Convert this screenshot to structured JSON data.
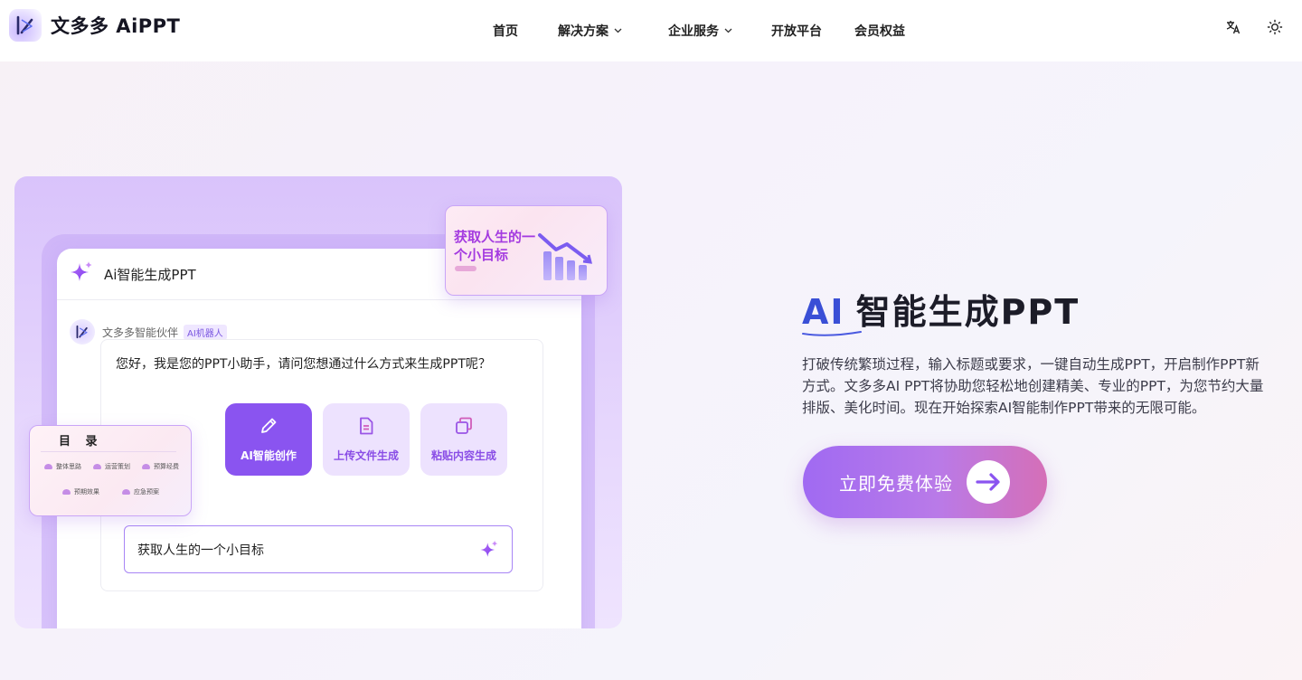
{
  "header": {
    "brand": "文多多 AiPPT",
    "nav": [
      {
        "label": "首页",
        "has_dropdown": false
      },
      {
        "label": "解决方案",
        "has_dropdown": true
      },
      {
        "label": "企业服务",
        "has_dropdown": true
      },
      {
        "label": "开放平台",
        "has_dropdown": false
      },
      {
        "label": "会员权益",
        "has_dropdown": false
      }
    ],
    "actions": {
      "translate_icon": "translate-icon",
      "theme_icon": "sun-icon"
    }
  },
  "demo": {
    "window_title": "Ai智能生成PPT",
    "bot_name": "文多多智能伙伴",
    "bot_tag": "AI机器人",
    "message": "您好，我是您的PPT小助手，请问您想通过什么方式来生成PPT呢？",
    "options": [
      {
        "label": "AI智能创作",
        "icon": "pencil-icon",
        "selected": true
      },
      {
        "label": "上传文件生成",
        "icon": "document-icon",
        "selected": false
      },
      {
        "label": "粘贴内容生成",
        "icon": "copy-icon",
        "selected": false
      }
    ],
    "input_value": "获取人生的一个小目标",
    "float_card_title": "获取人生的一个小目标",
    "toc": {
      "title": "目 录",
      "items": [
        "整体思路",
        "运营策划",
        "预算经费",
        "预期效果",
        "应急预案"
      ]
    }
  },
  "hero": {
    "title_ai": "AI",
    "title_rest": "智能生成PPT",
    "description": "打破传统繁琐过程，输入标题或要求，一键自动生成PPT，开启制作PPT新方式。文多多AI PPT将协助您轻松地创建精美、专业的PPT，为您节约大量排版、美化时间。现在开始探索AI智能制作PPT带来的无限可能。",
    "cta_label": "立即免费体验"
  },
  "colors": {
    "accent": "#8a54f0",
    "accent_light": "#ede2fe",
    "title_blue": "#3a4fd6",
    "cta_start": "#a06af2",
    "cta_end": "#d56fb7"
  }
}
